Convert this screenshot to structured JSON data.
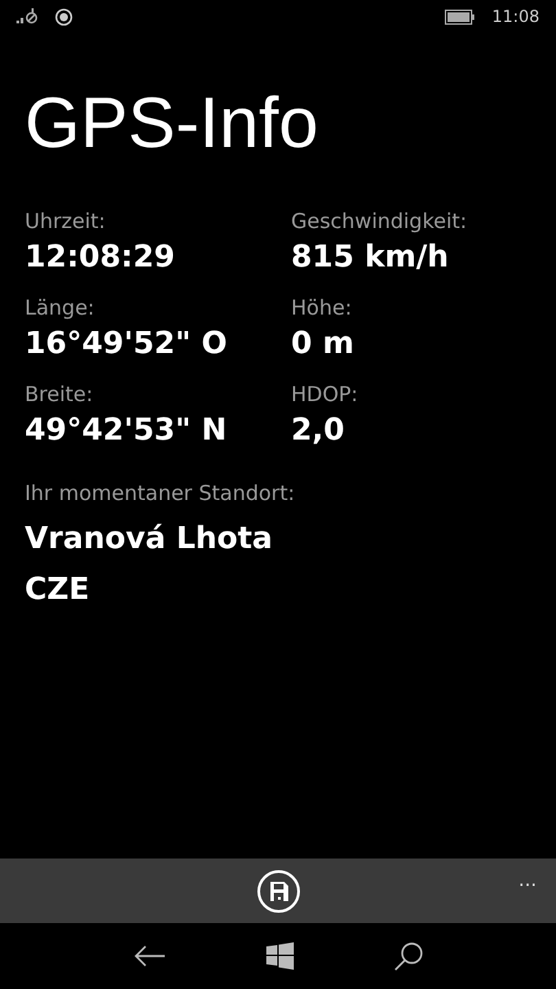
{
  "status_bar": {
    "time": "11:08"
  },
  "title": "GPS-Info",
  "fields": [
    {
      "label": "Uhrzeit:",
      "value": "12:08:29"
    },
    {
      "label": "Geschwindigkeit:",
      "value": "815 km/h"
    },
    {
      "label": "Länge:",
      "value": "16°49'52\" O"
    },
    {
      "label": "Höhe:",
      "value": "0 m"
    },
    {
      "label": "Breite:",
      "value": "49°42'53\" N"
    },
    {
      "label": "HDOP:",
      "value": "2,0"
    }
  ],
  "location": {
    "label": "Ihr momentaner Standort:",
    "lines": [
      "Vranová Lhota",
      "CZE"
    ]
  },
  "app_bar": {
    "more": "···"
  }
}
